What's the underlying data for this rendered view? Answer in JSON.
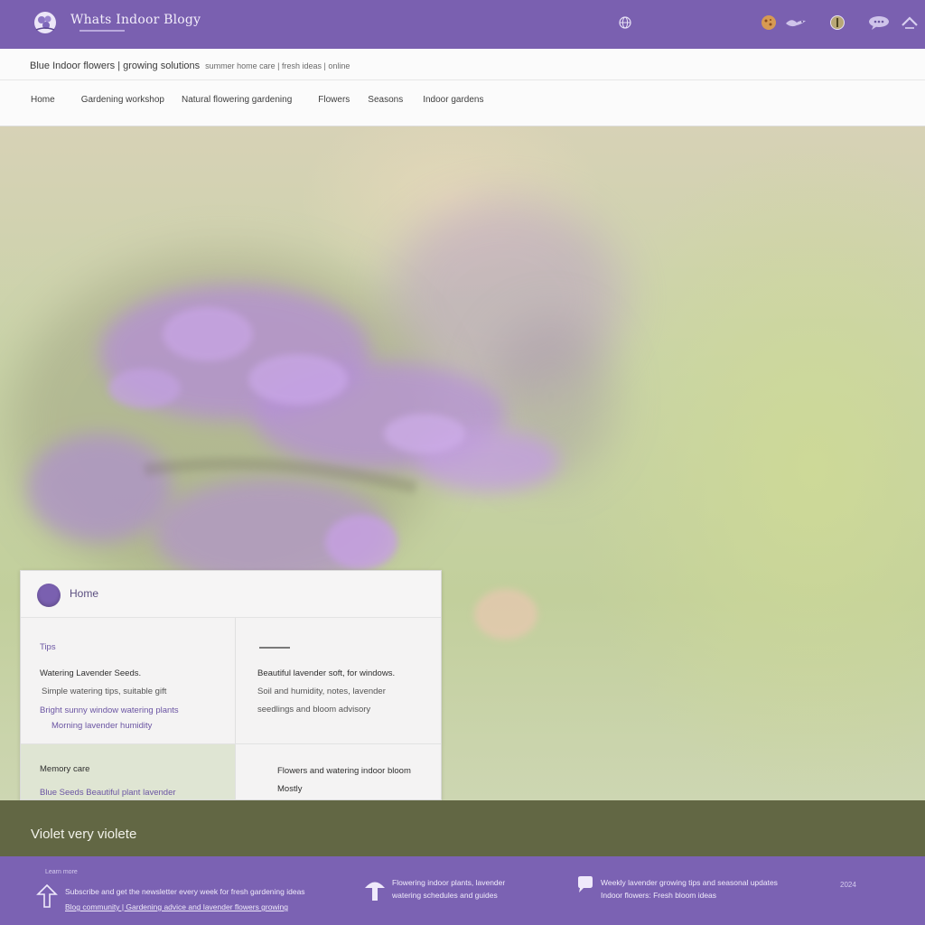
{
  "header": {
    "site_title": "Whats Indoor Blogy",
    "logo_icon": "flower-logo-icon",
    "globe_icon": "globe-icon",
    "icons": [
      "cookie-icon",
      "bird-icon",
      "circle-badge-icon",
      "chat-icon",
      "chevron-icon"
    ]
  },
  "subheader": {
    "breadcrumb": "Blue Indoor flowers | growing solutions",
    "breadcrumb_small": "summer home care | fresh ideas | online",
    "nav": [
      "Home",
      "Gardening workshop",
      "Natural flowering gardening",
      "Flowers",
      "Seasons",
      "Indoor gardens"
    ]
  },
  "card": {
    "title": "Home",
    "left_label": "Tips",
    "left_heading": "Watering Lavender Seeds.",
    "left_line1": "Simple watering tips, suitable gift",
    "left_link1": "Bright sunny window watering plants",
    "left_link2": "Morning lavender humidity",
    "right_heading": "Beautiful lavender soft, for windows.",
    "right_line1": "Soil and humidity, notes, lavender",
    "right_line2": "seedlings and bloom advisory",
    "bottom_left_label": "Memory care",
    "bottom_left_line": "Blue Seeds  Beautiful plant lavender",
    "bottom_right_line1": "Flowers and watering indoor bloom",
    "bottom_right_line2": "Mostly"
  },
  "band": {
    "text": "Violet very violete"
  },
  "footer": {
    "col1_small": "Learn more",
    "col1_line1": "Subscribe and get the newsletter every week for fresh gardening ideas",
    "col1_line2": "Blog community | Gardening advice and lavender flowers growing",
    "col2_line1": "Flowering indoor plants, lavender",
    "col2_line2": "watering schedules and guides",
    "col3_line1": "Weekly lavender growing tips and seasonal updates",
    "col3_line2": "Indoor flowers: Fresh bloom ideas",
    "col4": "2024",
    "icons": [
      "arrow-up-icon",
      "mushroom-icon",
      "chat-bubble-icon"
    ]
  },
  "colors": {
    "accent": "#7a60b0",
    "band": "#626744",
    "hero_green": "#c9d3a8",
    "flower": "#b48ed6"
  }
}
